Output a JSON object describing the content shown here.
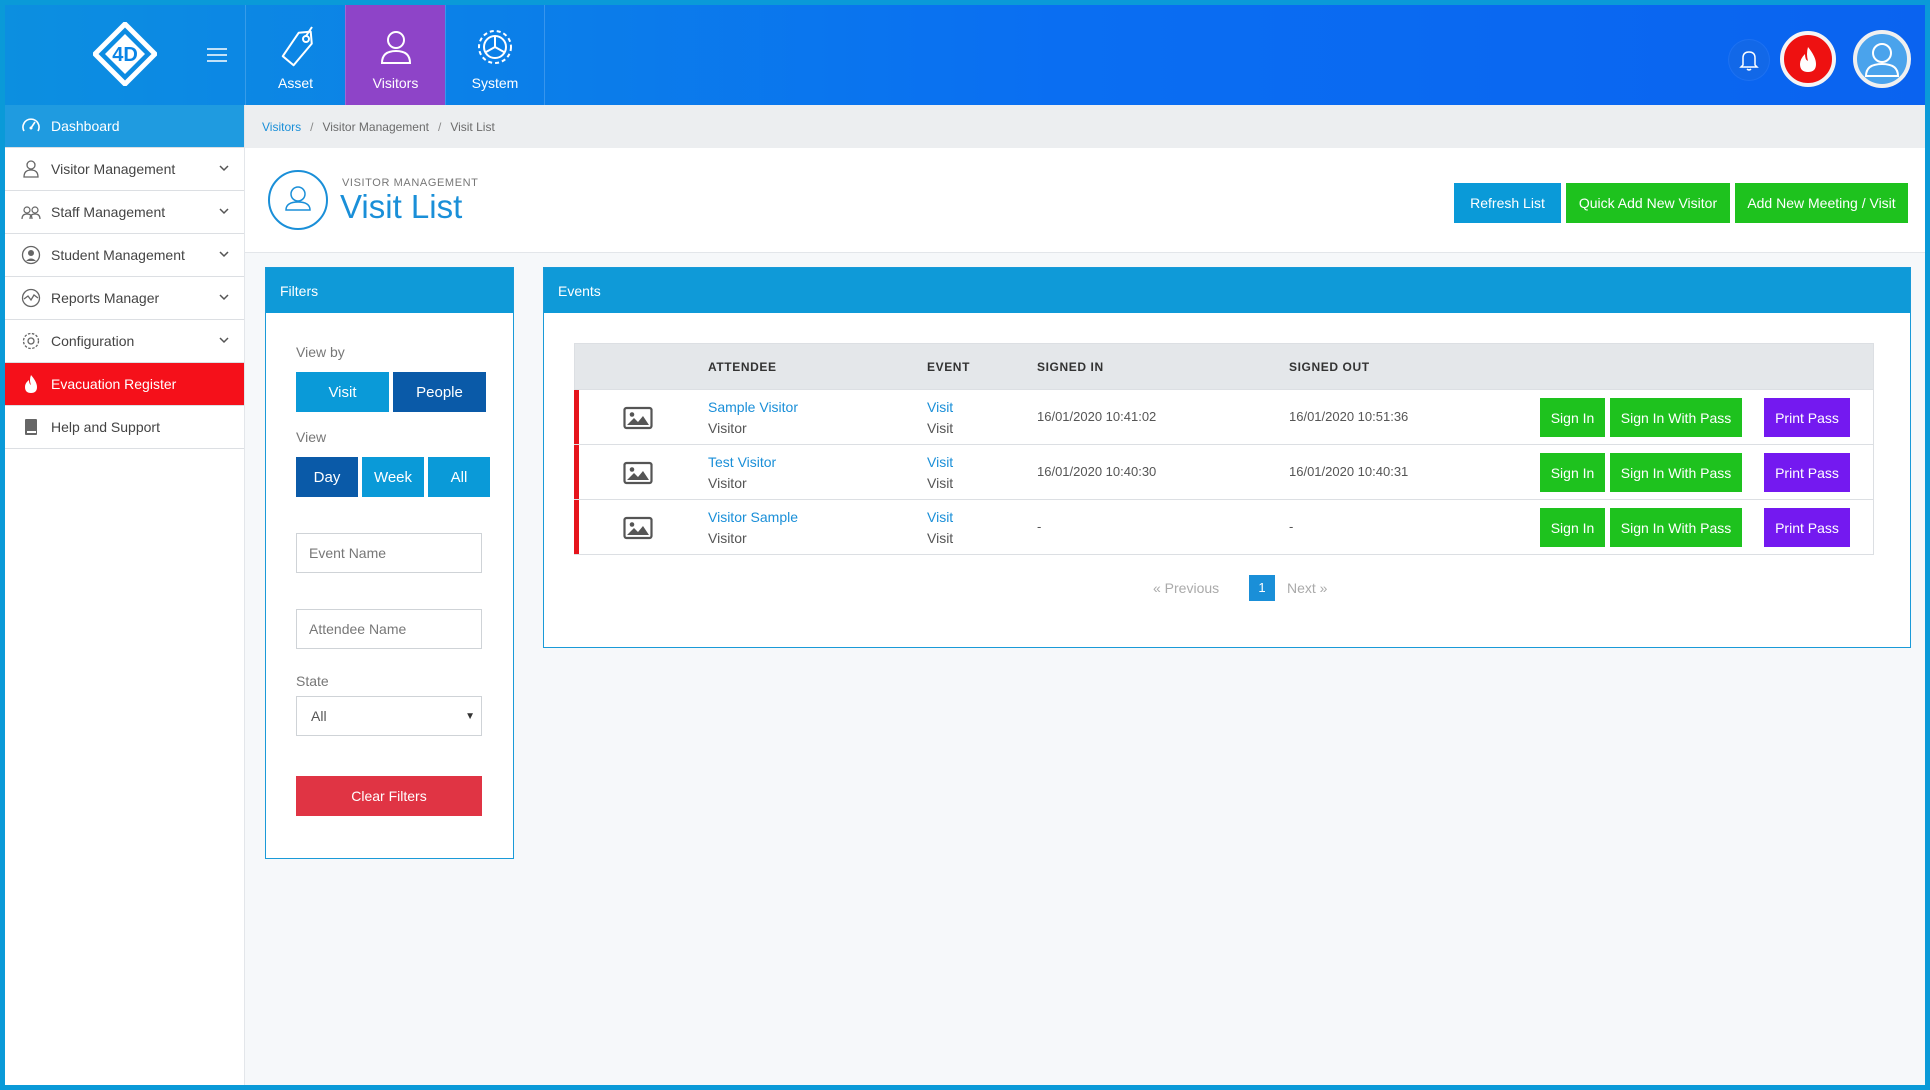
{
  "header": {
    "logo_text": "4D",
    "modules": [
      {
        "label": "Asset",
        "icon": "tag-icon"
      },
      {
        "label": "Visitors",
        "icon": "user-icon",
        "active": true
      },
      {
        "label": "System",
        "icon": "gear-icon"
      }
    ]
  },
  "sidebar": {
    "items": [
      {
        "label": "Dashboard",
        "icon": "speedometer-icon"
      },
      {
        "label": "Visitor Management",
        "icon": "user-icon"
      },
      {
        "label": "Staff Management",
        "icon": "users-icon"
      },
      {
        "label": "Student Management",
        "icon": "student-icon"
      },
      {
        "label": "Reports Manager",
        "icon": "chart-icon"
      },
      {
        "label": "Configuration",
        "icon": "gear-icon"
      },
      {
        "label": "Evacuation Register",
        "icon": "flame-icon"
      },
      {
        "label": "Help and Support",
        "icon": "book-icon"
      }
    ]
  },
  "breadcrumb": [
    "Visitors",
    "Visitor Management",
    "Visit List"
  ],
  "page": {
    "subtitle": "VISITOR MANAGEMENT",
    "title": "Visit List",
    "actions": {
      "refresh": "Refresh List",
      "quick_add": "Quick Add New Visitor",
      "add_meeting": "Add New Meeting / Visit"
    }
  },
  "filters": {
    "title": "Filters",
    "view_by_label": "View by",
    "view_by_options": [
      "Visit",
      "People"
    ],
    "view_by_selected": "People",
    "view_label": "View",
    "view_options": [
      "Day",
      "Week",
      "All"
    ],
    "view_selected": "Day",
    "event_name_placeholder": "Event Name",
    "attendee_name_placeholder": "Attendee Name",
    "state_label": "State",
    "state_value": "All",
    "clear_button": "Clear Filters"
  },
  "events": {
    "title": "Events",
    "columns": {
      "attendee": "ATTENDEE",
      "event": "EVENT",
      "signed_in": "SIGNED IN",
      "signed_out": "SIGNED OUT"
    },
    "rows": [
      {
        "attendee": "Sample Visitor",
        "attendee_type": "Visitor",
        "event": "Visit",
        "event_type": "Visit",
        "signed_in": "16/01/2020 10:41:02",
        "signed_out": "16/01/2020 10:51:36"
      },
      {
        "attendee": "Test Visitor",
        "attendee_type": "Visitor",
        "event": "Visit",
        "event_type": "Visit",
        "signed_in": "16/01/2020 10:40:30",
        "signed_out": "16/01/2020 10:40:31"
      },
      {
        "attendee": "Visitor Sample",
        "attendee_type": "Visitor",
        "event": "Visit",
        "event_type": "Visit",
        "signed_in": "-",
        "signed_out": "-"
      }
    ],
    "row_actions": {
      "sign_in": "Sign In",
      "sign_in_with_pass": "Sign In With Pass",
      "print_pass": "Print Pass"
    },
    "pagination": {
      "previous": "«   Previous",
      "current": "1",
      "next": "Next   »"
    }
  },
  "colors": {
    "primary": "#0a9ad8",
    "dark_blue": "#0a5aa8",
    "green": "#1ec21e",
    "purple": "#7419f0",
    "red": "#e03444",
    "alert_red": "#f5101a",
    "module_active": "#8e44c8"
  }
}
